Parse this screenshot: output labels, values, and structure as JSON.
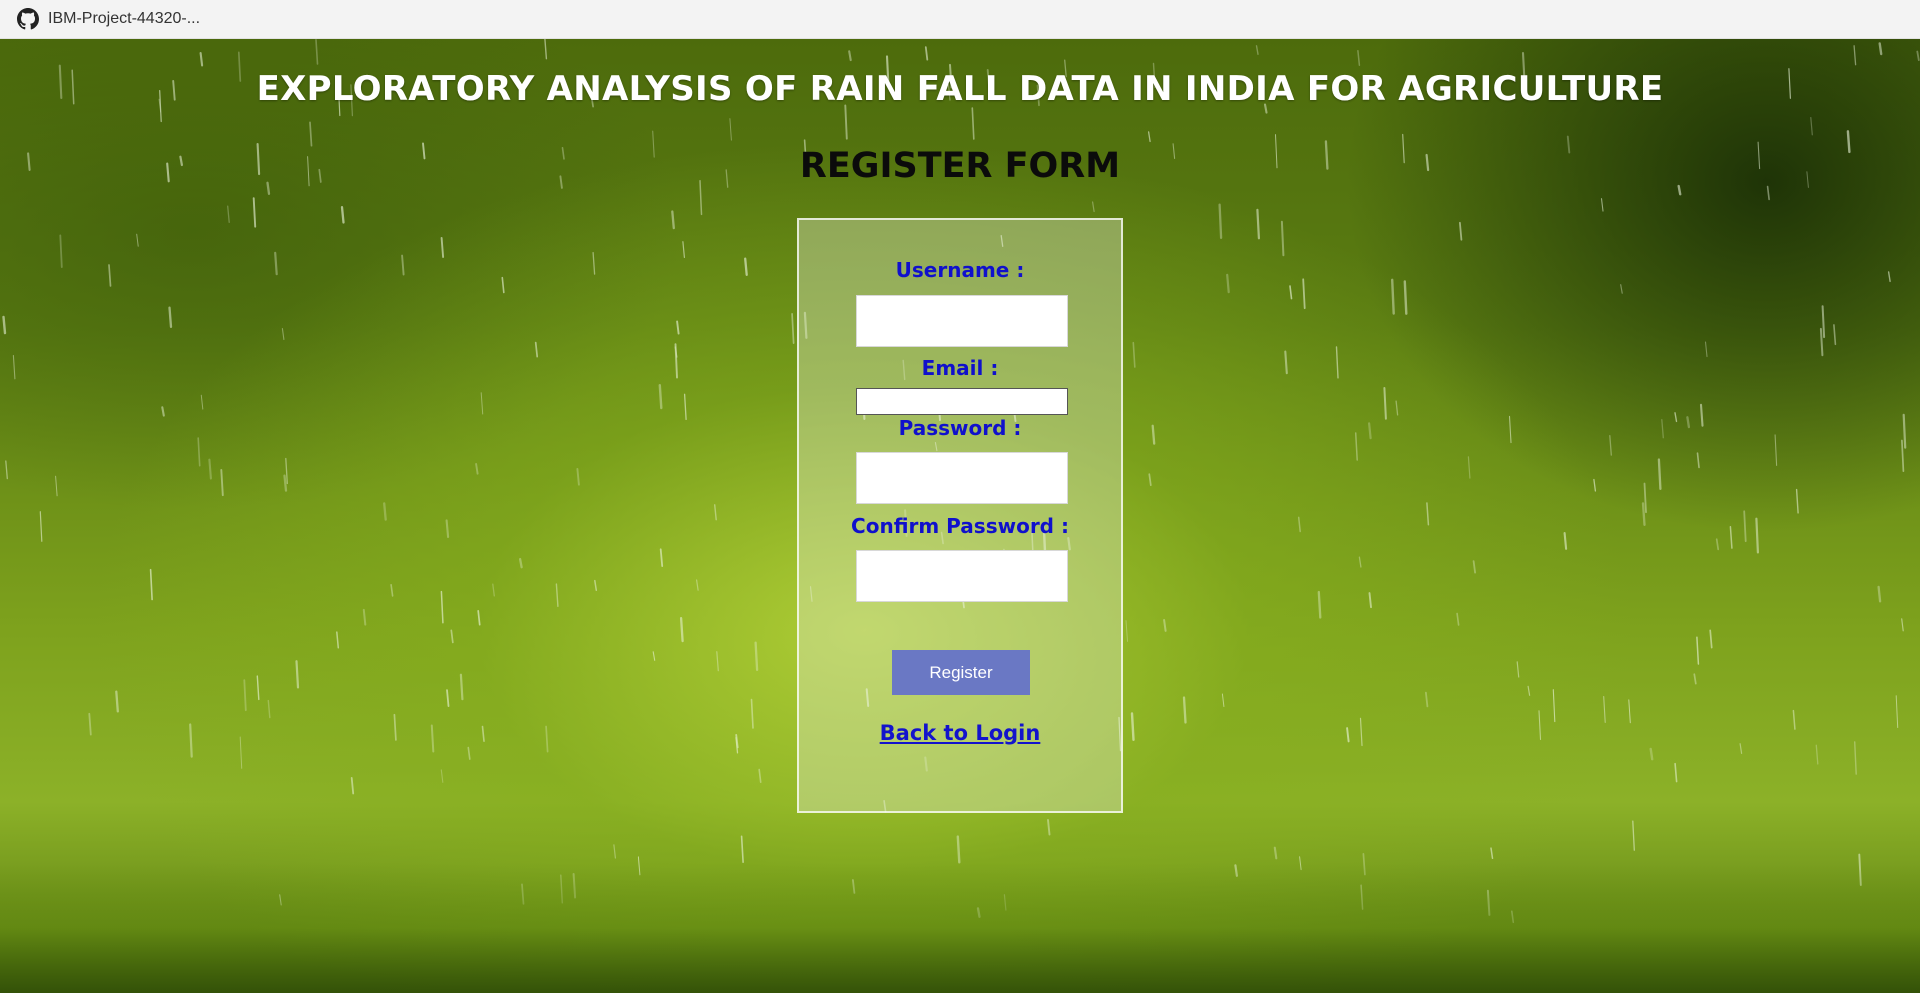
{
  "tab": {
    "icon": "github-icon",
    "title": "IBM-Project-44320-..."
  },
  "page": {
    "title": "EXPLORATORY ANALYSIS OF RAIN FALL DATA IN INDIA FOR AGRICULTURE",
    "form_title": "REGISTER FORM"
  },
  "form": {
    "username_label": "Username :",
    "username_value": "",
    "email_label": "Email :",
    "email_value": "",
    "password_label": "Password :",
    "password_value": "",
    "confirm_password_label": "Confirm Password :",
    "confirm_password_value": "",
    "register_label": "Register",
    "back_link_label": "Back to Login"
  },
  "colors": {
    "label": "#1010cc",
    "button": "#6a78c4",
    "link": "#1313cc"
  }
}
